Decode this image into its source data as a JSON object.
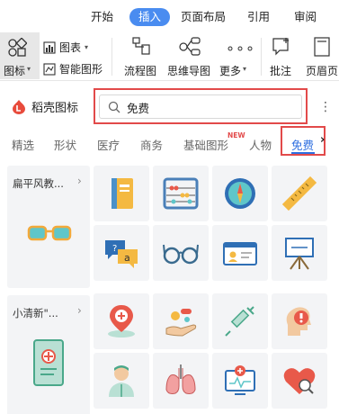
{
  "ribbon_tabs": {
    "start": "开始",
    "insert": "插入",
    "layout": "页面布局",
    "reference": "引用",
    "review": "审阅"
  },
  "toolbar": {
    "icon": "图标",
    "chart": "图表",
    "smart_graphics": "智能图形",
    "flowchart": "流程图",
    "mindmap": "思维导图",
    "more": "更多",
    "comment": "批注",
    "header_footer": "页眉页"
  },
  "panel": {
    "brand": "稻壳图标",
    "search": {
      "value": "免费",
      "placeholder": ""
    }
  },
  "categories": {
    "items": [
      "精选",
      "形状",
      "医疗",
      "商务",
      "基础图形",
      "人物",
      "免费"
    ],
    "active": "免费",
    "new_badge": "NEW"
  },
  "groups": [
    {
      "title": "扁平风教...",
      "icons": [
        "notebook-icon",
        "abacus-icon",
        "compass-icon",
        "ruler-icon",
        "chat-bubble-icon",
        "glasses-icon",
        "id-card-icon",
        "easel-board-icon"
      ]
    },
    {
      "title": "小清新\"...",
      "icons": [
        "medical-location-icon",
        "pills-hand-icon",
        "syringe-icon",
        "head-forbidden-icon",
        "doctor-icon",
        "lungs-icon",
        "medical-monitor-icon",
        "heart-search-icon"
      ]
    }
  ],
  "colors": {
    "accent": "#4a8cf0",
    "active_text": "#2f6fe0",
    "highlight": "#e24a4a",
    "card_bg": "#f3f4f6"
  }
}
